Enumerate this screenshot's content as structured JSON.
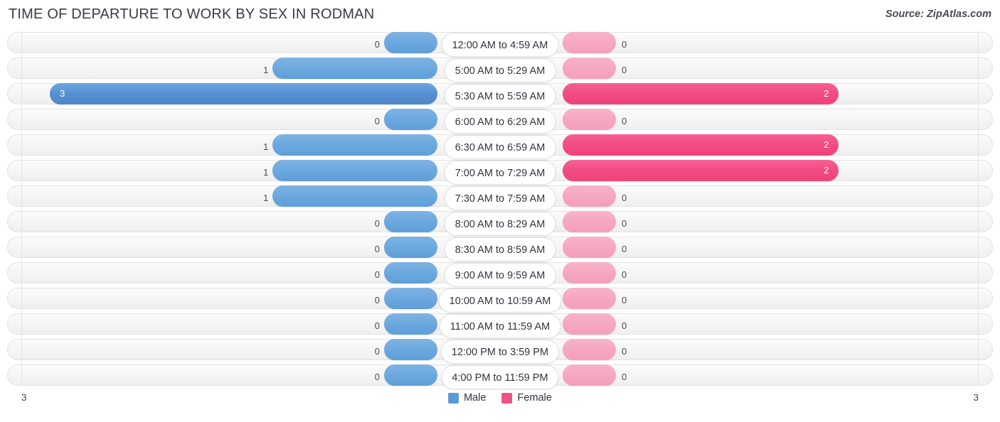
{
  "header": {
    "title": "TIME OF DEPARTURE TO WORK BY SEX IN RODMAN",
    "source": "Source: ZipAtlas.com"
  },
  "legend": {
    "male_label": "Male",
    "female_label": "Female",
    "male_color": "#5b9bd5",
    "female_color": "#ef5285"
  },
  "axis": {
    "left_label": "3",
    "right_label": "3"
  },
  "chart_data": {
    "type": "bar",
    "orientation": "horizontal-diverging",
    "title": "TIME OF DEPARTURE TO WORK BY SEX IN RODMAN",
    "xlabel": "",
    "ylabel": "",
    "xlim": [
      3,
      0,
      3
    ],
    "grid": false,
    "legend_position": "bottom-center",
    "categories": [
      "12:00 AM to 4:59 AM",
      "5:00 AM to 5:29 AM",
      "5:30 AM to 5:59 AM",
      "6:00 AM to 6:29 AM",
      "6:30 AM to 6:59 AM",
      "7:00 AM to 7:29 AM",
      "7:30 AM to 7:59 AM",
      "8:00 AM to 8:29 AM",
      "8:30 AM to 8:59 AM",
      "9:00 AM to 9:59 AM",
      "10:00 AM to 10:59 AM",
      "11:00 AM to 11:59 AM",
      "12:00 PM to 3:59 PM",
      "4:00 PM to 11:59 PM"
    ],
    "series": [
      {
        "name": "Male",
        "values": [
          0,
          1,
          3,
          0,
          1,
          1,
          1,
          0,
          0,
          0,
          0,
          0,
          0,
          0
        ]
      },
      {
        "name": "Female",
        "values": [
          0,
          0,
          2,
          0,
          2,
          2,
          0,
          0,
          0,
          0,
          0,
          0,
          0,
          0
        ]
      }
    ],
    "rows": [
      {
        "category": "12:00 AM to 4:59 AM",
        "male": 0,
        "female": 0,
        "male_text": "0",
        "female_text": "0"
      },
      {
        "category": "5:00 AM to 5:29 AM",
        "male": 1,
        "female": 0,
        "male_text": "1",
        "female_text": "0"
      },
      {
        "category": "5:30 AM to 5:59 AM",
        "male": 3,
        "female": 2,
        "male_text": "3",
        "female_text": "2"
      },
      {
        "category": "6:00 AM to 6:29 AM",
        "male": 0,
        "female": 0,
        "male_text": "0",
        "female_text": "0"
      },
      {
        "category": "6:30 AM to 6:59 AM",
        "male": 1,
        "female": 2,
        "male_text": "1",
        "female_text": "2"
      },
      {
        "category": "7:00 AM to 7:29 AM",
        "male": 1,
        "female": 2,
        "male_text": "1",
        "female_text": "2"
      },
      {
        "category": "7:30 AM to 7:59 AM",
        "male": 1,
        "female": 0,
        "male_text": "1",
        "female_text": "0"
      },
      {
        "category": "8:00 AM to 8:29 AM",
        "male": 0,
        "female": 0,
        "male_text": "0",
        "female_text": "0"
      },
      {
        "category": "8:30 AM to 8:59 AM",
        "male": 0,
        "female": 0,
        "male_text": "0",
        "female_text": "0"
      },
      {
        "category": "9:00 AM to 9:59 AM",
        "male": 0,
        "female": 0,
        "male_text": "0",
        "female_text": "0"
      },
      {
        "category": "10:00 AM to 10:59 AM",
        "male": 0,
        "female": 0,
        "male_text": "0",
        "female_text": "0"
      },
      {
        "category": "11:00 AM to 11:59 AM",
        "male": 0,
        "female": 0,
        "male_text": "0",
        "female_text": "0"
      },
      {
        "category": "12:00 PM to 3:59 PM",
        "male": 0,
        "female": 0,
        "male_text": "0",
        "female_text": "0"
      },
      {
        "category": "4:00 PM to 11:59 PM",
        "male": 0,
        "female": 0,
        "male_text": "0",
        "female_text": "0"
      }
    ]
  }
}
